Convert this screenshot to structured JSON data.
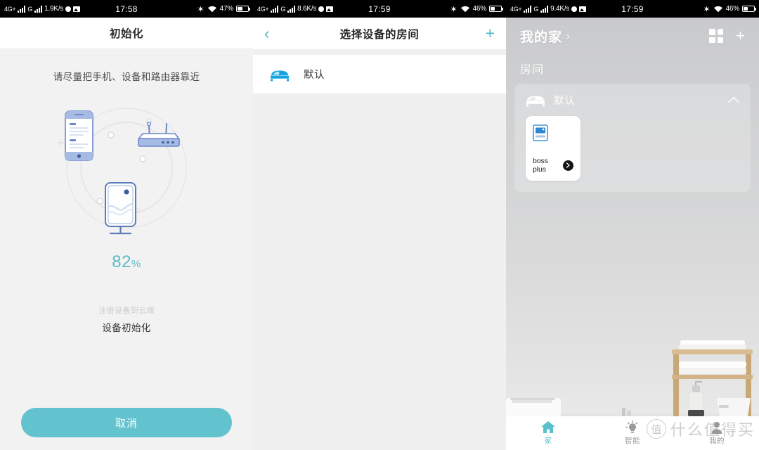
{
  "status_bars": [
    {
      "network": "4G+",
      "carrier2": "G",
      "speed": "1.9K/s",
      "time": "17:58",
      "battery": "47%"
    },
    {
      "network": "4G+",
      "carrier2": "G",
      "speed": "8.6K/s",
      "time": "17:59",
      "battery": "46%"
    },
    {
      "network": "4G+",
      "carrier2": "G",
      "speed": "9.4K/s",
      "time": "17:59",
      "battery": "46%"
    }
  ],
  "panel_init": {
    "title": "初始化",
    "hint": "请尽量把手机、设备和路由器靠近",
    "progress_value": "82",
    "progress_symbol": "%",
    "step_done": "注册设备到云端",
    "step_current": "设备初始化",
    "cancel_label": "取消",
    "accent_color": "#5bbcc8",
    "button_color": "#62c3ce"
  },
  "panel_room_select": {
    "title": "选择设备的房间",
    "back_icon": "‹",
    "add_icon": "+",
    "accent_color": "#4ab6bf",
    "rooms": [
      {
        "name": "默认",
        "icon": "bed-icon"
      }
    ]
  },
  "panel_home": {
    "home_name": "我的家",
    "home_chevron": "›",
    "grid_icon": "grid-icon",
    "add_icon": "+",
    "section_label": "房间",
    "room": {
      "name": "默认",
      "icon": "bed-icon",
      "collapse_icon": "^"
    },
    "devices": [
      {
        "name": "boss plus",
        "icon": "device-icon"
      }
    ],
    "tabs": [
      {
        "label": "家",
        "icon": "home-icon",
        "active": true
      },
      {
        "label": "智能",
        "icon": "bulb-icon",
        "active": false
      },
      {
        "label": "我的",
        "icon": "person-icon",
        "active": false
      }
    ],
    "tab_active_color": "#5bc0cb"
  },
  "watermark": {
    "mark": "值",
    "text": "什么值得买"
  }
}
